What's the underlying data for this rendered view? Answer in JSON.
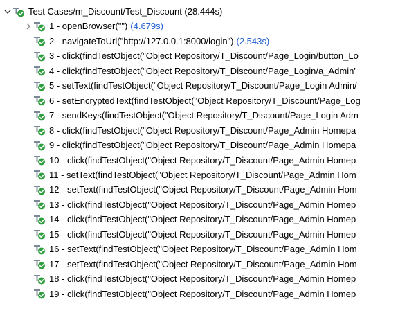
{
  "theme": {
    "time_color": "#1f5fd1",
    "pass_green": "#2e9e3e",
    "icon_gray": "#7a8896"
  },
  "root": {
    "label": "Test Cases/m_Discount/Test_Discount (28.444s)",
    "expanded": true,
    "chevron_icon": "chevron-down-icon",
    "status_icon": "passed-status-icon"
  },
  "steps": [
    {
      "label": "1 - openBrowser(\"\")",
      "time": "(4.679s)",
      "chevron_icon": "chevron-right-icon"
    },
    {
      "label": "2 - navigateToUrl(\"http://127.0.0.1:8000/login\")",
      "time": "(2.543s)"
    },
    {
      "label": "3 - click(findTestObject(\"Object Repository/T_Discount/Page_Login/button_Lo"
    },
    {
      "label": "4 - click(findTestObject(\"Object Repository/T_Discount/Page_Login/a_Admin'"
    },
    {
      "label": "5 - setText(findTestObject(\"Object Repository/T_Discount/Page_Login Admin/"
    },
    {
      "label": "6 - setEncryptedText(findTestObject(\"Object Repository/T_Discount/Page_Log"
    },
    {
      "label": "7 - sendKeys(findTestObject(\"Object Repository/T_Discount/Page_Login Adm"
    },
    {
      "label": "8 - click(findTestObject(\"Object Repository/T_Discount/Page_Admin Homepa"
    },
    {
      "label": "9 - click(findTestObject(\"Object Repository/T_Discount/Page_Admin Homepa"
    },
    {
      "label": "10 - click(findTestObject(\"Object Repository/T_Discount/Page_Admin Homep"
    },
    {
      "label": "11 - setText(findTestObject(\"Object Repository/T_Discount/Page_Admin Hom"
    },
    {
      "label": "12 - setText(findTestObject(\"Object Repository/T_Discount/Page_Admin Hom"
    },
    {
      "label": "13 - click(findTestObject(\"Object Repository/T_Discount/Page_Admin Homep"
    },
    {
      "label": "14 - click(findTestObject(\"Object Repository/T_Discount/Page_Admin Homep"
    },
    {
      "label": "15 - click(findTestObject(\"Object Repository/T_Discount/Page_Admin Homep"
    },
    {
      "label": "16 - setText(findTestObject(\"Object Repository/T_Discount/Page_Admin Hom"
    },
    {
      "label": "17 - setText(findTestObject(\"Object Repository/T_Discount/Page_Admin Hom"
    },
    {
      "label": "18 - click(findTestObject(\"Object Repository/T_Discount/Page_Admin Homep"
    },
    {
      "label": "19 - click(findTestObject(\"Object Repository/T_Discount/Page_Admin Homep"
    }
  ]
}
